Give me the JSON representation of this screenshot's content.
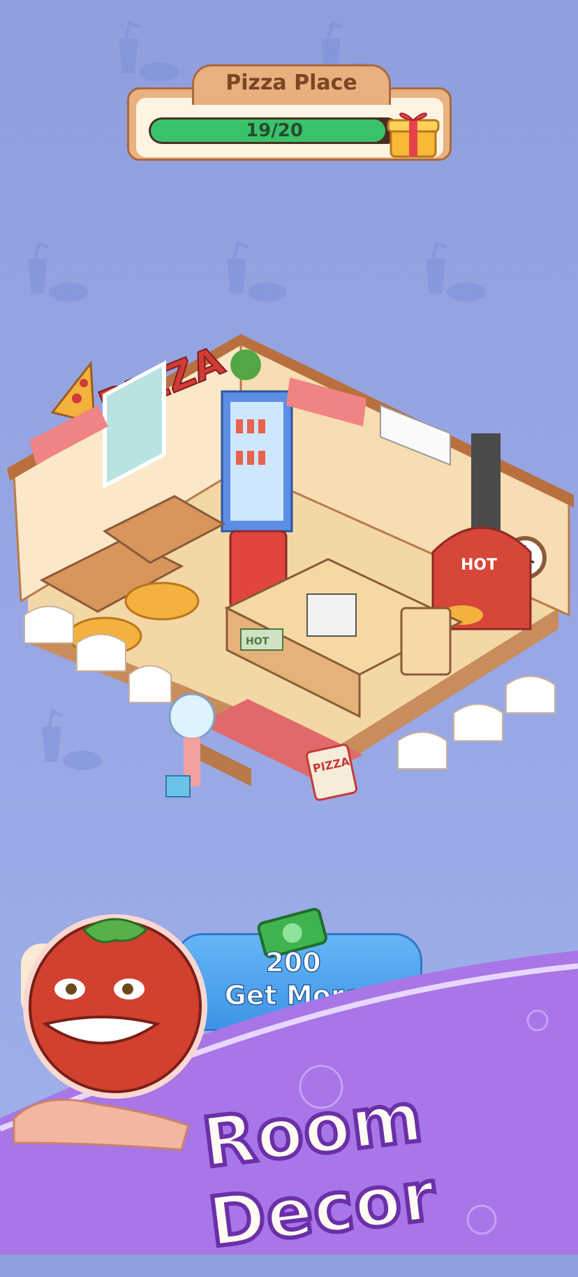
{
  "header": {
    "title": "Pizza Place",
    "progress_text": "19/20",
    "progress_value": 0.95
  },
  "room": {
    "sign_text": "PIZZA",
    "oven_label": "HOT",
    "counter_label": "HOT",
    "floor_sign": "PIZZA"
  },
  "get_more": {
    "amount": "200",
    "label": "Get More"
  },
  "banner": {
    "title": "Room Decor"
  },
  "icons": [
    "gift-icon",
    "cash-icon",
    "tomato-mascot",
    "cup-burger-icon"
  ],
  "colors": {
    "background": "#97a6e3",
    "progress_fill": "#39c26a",
    "button_blue": "#4aa1ee",
    "banner_purple": "#a877e8"
  }
}
